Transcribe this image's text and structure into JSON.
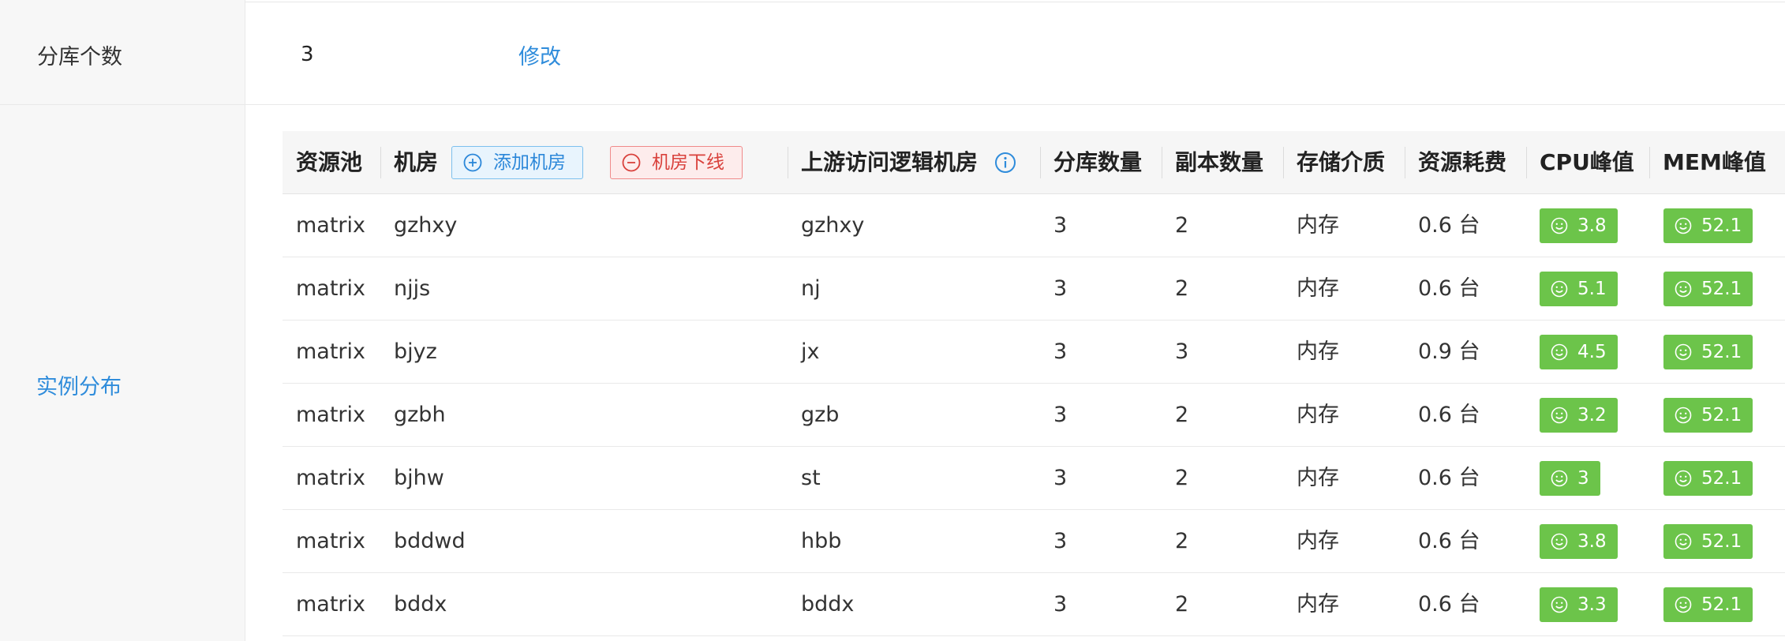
{
  "config": {
    "shard_count_label": "分库个数",
    "shard_count_value": "3",
    "edit_link": "修改",
    "instance_distribution_label": "实例分布"
  },
  "table": {
    "headers": {
      "pool": "资源池",
      "room": "机房",
      "add_room_button": "添加机房",
      "offline_room_button": "机房下线",
      "upstream": "上游访问逻辑机房",
      "shard_count": "分库数量",
      "replica_count": "副本数量",
      "storage": "存储介质",
      "cost": "资源耗费",
      "cpu_peak": "CPU峰值",
      "mem_peak": "MEM峰值"
    },
    "rows": [
      {
        "pool": "matrix",
        "room": "gzhxy",
        "upstream": "gzhxy",
        "shards": "3",
        "replicas": "2",
        "storage": "内存",
        "cost": "0.6 台",
        "cpu": "3.8",
        "mem": "52.1"
      },
      {
        "pool": "matrix",
        "room": "njjs",
        "upstream": "nj",
        "shards": "3",
        "replicas": "2",
        "storage": "内存",
        "cost": "0.6 台",
        "cpu": "5.1",
        "mem": "52.1"
      },
      {
        "pool": "matrix",
        "room": "bjyz",
        "upstream": "jx",
        "shards": "3",
        "replicas": "3",
        "storage": "内存",
        "cost": "0.9 台",
        "cpu": "4.5",
        "mem": "52.1"
      },
      {
        "pool": "matrix",
        "room": "gzbh",
        "upstream": "gzb",
        "shards": "3",
        "replicas": "2",
        "storage": "内存",
        "cost": "0.6 台",
        "cpu": "3.2",
        "mem": "52.1"
      },
      {
        "pool": "matrix",
        "room": "bjhw",
        "upstream": "st",
        "shards": "3",
        "replicas": "2",
        "storage": "内存",
        "cost": "0.6 台",
        "cpu": "3",
        "mem": "52.1"
      },
      {
        "pool": "matrix",
        "room": "bddwd",
        "upstream": "hbb",
        "shards": "3",
        "replicas": "2",
        "storage": "内存",
        "cost": "0.6 台",
        "cpu": "3.8",
        "mem": "52.1"
      },
      {
        "pool": "matrix",
        "room": "bddx",
        "upstream": "bddx",
        "shards": "3",
        "replicas": "2",
        "storage": "内存",
        "cost": "0.6 台",
        "cpu": "3.3",
        "mem": "52.1"
      }
    ]
  },
  "icons": {
    "add": "plus-circle-icon",
    "offline": "minus-circle-icon",
    "info": "info-circle-icon",
    "badge": "smile-icon"
  },
  "colors": {
    "link": "#2f8cdb",
    "badge_green": "#6cc44a",
    "add_btn_border": "#7cc0ee",
    "del_btn_border": "#f08a8a"
  }
}
